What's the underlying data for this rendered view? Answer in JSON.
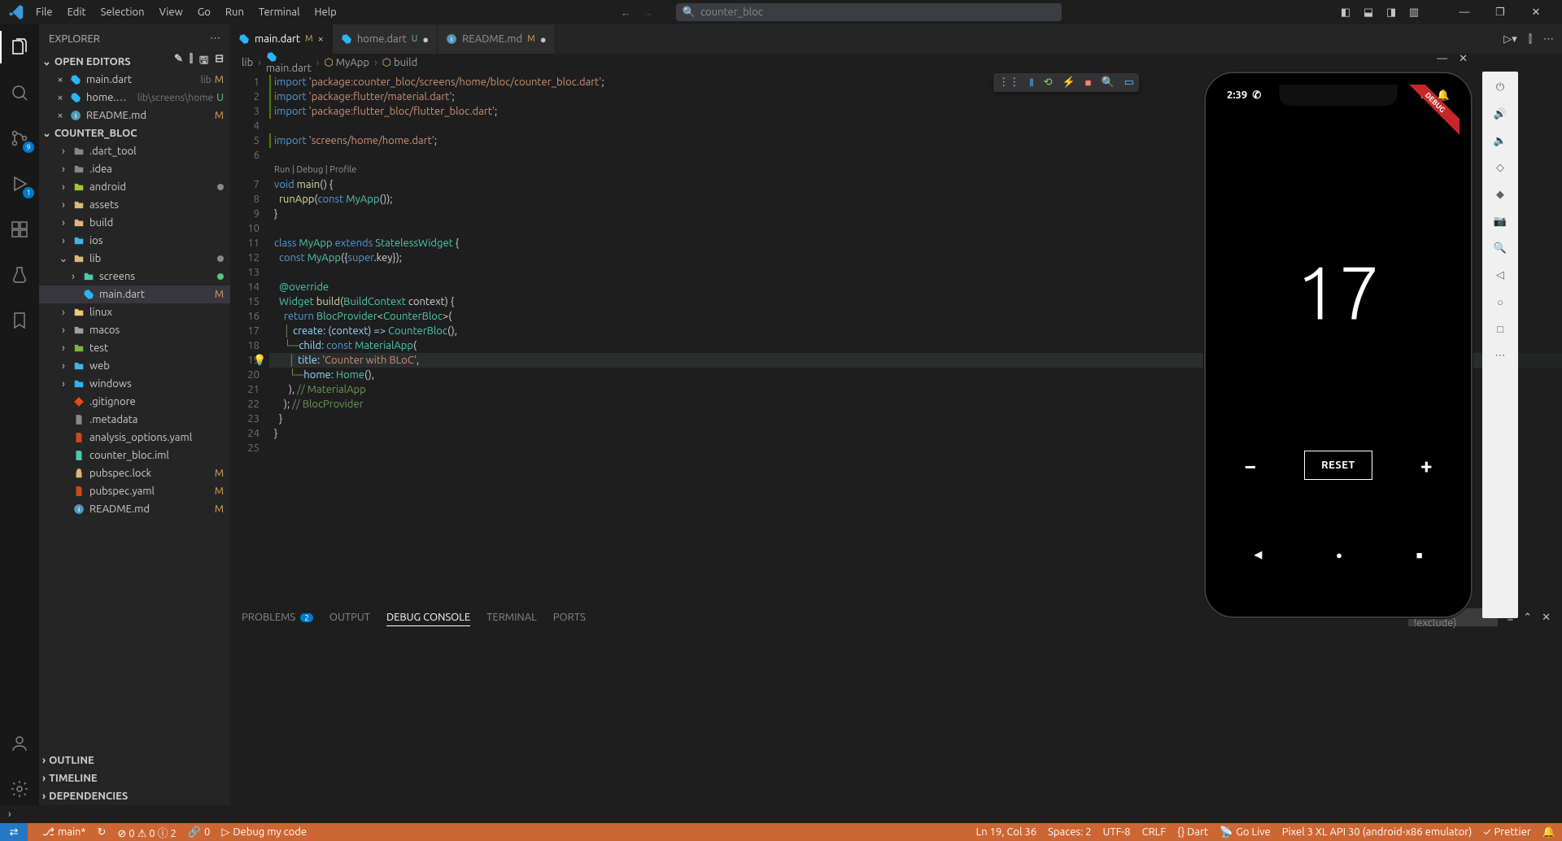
{
  "titlebar": {
    "menu": [
      "File",
      "Edit",
      "Selection",
      "View",
      "Go",
      "Run",
      "Terminal",
      "Help"
    ],
    "search": "counter_bloc"
  },
  "activitybar": {
    "sourceControlBadge": "9",
    "debugBadge": "1"
  },
  "sidebar": {
    "title": "EXPLORER",
    "section_open_editors": "OPEN EDITORS",
    "openEditors": [
      {
        "icon": "dart",
        "name": "main.dart",
        "desc": "lib",
        "badge": "M"
      },
      {
        "icon": "dart",
        "name": "home.dart",
        "desc": "lib\\screens\\home",
        "badge": "U"
      },
      {
        "icon": "info",
        "name": "README.md",
        "desc": "",
        "badge": "M",
        "dotColor": "#fff"
      }
    ],
    "section_project": "COUNTER_BLOC",
    "tree": [
      {
        "indent": 1,
        "tw": ">",
        "icon": "folder",
        "name": ".dart_tool",
        "color": "#888"
      },
      {
        "indent": 1,
        "tw": ">",
        "icon": "folder",
        "name": ".idea",
        "color": "#888"
      },
      {
        "indent": 1,
        "tw": ">",
        "icon": "folder-and",
        "name": "android",
        "color": "#a4c639",
        "dot": "#888888"
      },
      {
        "indent": 1,
        "tw": ">",
        "icon": "folder",
        "name": "assets",
        "color": "#dcb67a"
      },
      {
        "indent": 1,
        "tw": ">",
        "icon": "folder",
        "name": "build",
        "color": "#dcb67a"
      },
      {
        "indent": 1,
        "tw": ">",
        "icon": "folder",
        "name": "ios",
        "color": "#41b6e6"
      },
      {
        "indent": 1,
        "tw": "v",
        "icon": "folder",
        "name": "lib",
        "color": "#dcb67a",
        "dot": "#888888"
      },
      {
        "indent": 2,
        "tw": ">",
        "icon": "folder",
        "name": "screens",
        "color": "#4ec9b0",
        "dot": "#50c878"
      },
      {
        "indent": 2,
        "tw": "",
        "icon": "dart",
        "name": "main.dart",
        "badge": "M",
        "selected": true
      },
      {
        "indent": 1,
        "tw": ">",
        "icon": "folder",
        "name": "linux",
        "color": "#f0c674"
      },
      {
        "indent": 1,
        "tw": ">",
        "icon": "folder",
        "name": "macos",
        "color": "#a0a0a0"
      },
      {
        "indent": 1,
        "tw": ">",
        "icon": "folder",
        "name": "test",
        "color": "#7cb342"
      },
      {
        "indent": 1,
        "tw": ">",
        "icon": "folder",
        "name": "web",
        "color": "#41b6e6"
      },
      {
        "indent": 1,
        "tw": ">",
        "icon": "folder",
        "name": "windows",
        "color": "#29b6f6"
      },
      {
        "indent": 1,
        "tw": "",
        "icon": "git",
        "name": ".gitignore"
      },
      {
        "indent": 1,
        "tw": "",
        "icon": "file",
        "name": ".metadata"
      },
      {
        "indent": 1,
        "tw": "",
        "icon": "yaml",
        "name": "analysis_options.yaml",
        "iconColor": "#cb4b16"
      },
      {
        "indent": 1,
        "tw": "",
        "icon": "file",
        "name": "counter_bloc.iml",
        "iconColor": "#4ec9b0"
      },
      {
        "indent": 1,
        "tw": "",
        "icon": "lock",
        "name": "pubspec.lock",
        "badge": "M",
        "iconColor": "#dcb67a"
      },
      {
        "indent": 1,
        "tw": "",
        "icon": "yaml",
        "name": "pubspec.yaml",
        "badge": "M",
        "iconColor": "#cb4b16"
      },
      {
        "indent": 1,
        "tw": "",
        "icon": "info",
        "name": "README.md",
        "badge": "M"
      }
    ],
    "bottom": [
      "OUTLINE",
      "TIMELINE",
      "DEPENDENCIES"
    ]
  },
  "tabs": [
    {
      "icon": "dart",
      "name": "main.dart",
      "status": "M",
      "active": true,
      "close": "×"
    },
    {
      "icon": "dart",
      "name": "home.dart",
      "status": "U",
      "close": "●",
      "statusColor": "#6fc28b"
    },
    {
      "icon": "info",
      "name": "README.md",
      "status": "M",
      "close": "●"
    }
  ],
  "breadcrumb": [
    "lib",
    "main.dart",
    "MyApp",
    "build"
  ],
  "code": {
    "codelens": "Run | Debug | Profile",
    "lines": [
      [
        {
          "t": "import ",
          "c": "tk-kw"
        },
        {
          "t": "'package:counter_bloc/screens/home/bloc/counter_bloc.dart'",
          "c": "tk-str"
        },
        {
          "t": ";",
          "c": "tk-p"
        }
      ],
      [
        {
          "t": "import ",
          "c": "tk-kw"
        },
        {
          "t": "'package:flutter/material.dart'",
          "c": "tk-str"
        },
        {
          "t": ";",
          "c": "tk-p"
        }
      ],
      [
        {
          "t": "import ",
          "c": "tk-kw"
        },
        {
          "t": "'package:flutter_bloc/flutter_bloc.dart'",
          "c": "tk-str"
        },
        {
          "t": ";",
          "c": "tk-p"
        }
      ],
      [],
      [
        {
          "t": "import ",
          "c": "tk-kw"
        },
        {
          "t": "'screens/home/home.dart'",
          "c": "tk-str"
        },
        {
          "t": ";",
          "c": "tk-p"
        }
      ],
      [],
      "CODELENS",
      [
        {
          "t": "void ",
          "c": "tk-kw"
        },
        {
          "t": "main",
          "c": "tk-fn"
        },
        {
          "t": "() {",
          "c": "tk-p"
        }
      ],
      [
        {
          "t": "  ",
          "c": ""
        },
        {
          "t": "runApp",
          "c": "tk-fn"
        },
        {
          "t": "(",
          "c": "tk-p"
        },
        {
          "t": "const ",
          "c": "tk-kw"
        },
        {
          "t": "MyApp",
          "c": "tk-cls"
        },
        {
          "t": "());",
          "c": "tk-p"
        }
      ],
      [
        {
          "t": "}",
          "c": "tk-p"
        }
      ],
      [],
      [
        {
          "t": "class ",
          "c": "tk-kw"
        },
        {
          "t": "MyApp ",
          "c": "tk-cls"
        },
        {
          "t": "extends ",
          "c": "tk-kw"
        },
        {
          "t": "StatelessWidget ",
          "c": "tk-cls"
        },
        {
          "t": "{",
          "c": "tk-p"
        }
      ],
      [
        {
          "t": "  ",
          "c": ""
        },
        {
          "t": "const ",
          "c": "tk-kw"
        },
        {
          "t": "MyApp",
          "c": "tk-cls"
        },
        {
          "t": "({",
          "c": "tk-p"
        },
        {
          "t": "super",
          "c": "tk-kw"
        },
        {
          "t": ".key});",
          "c": "tk-p"
        }
      ],
      [],
      [
        {
          "t": "  ",
          "c": ""
        },
        {
          "t": "@override",
          "c": "tk-d"
        }
      ],
      [
        {
          "t": "  ",
          "c": ""
        },
        {
          "t": "Widget ",
          "c": "tk-cls"
        },
        {
          "t": "build",
          "c": "tk-fn"
        },
        {
          "t": "(",
          "c": "tk-p"
        },
        {
          "t": "BuildContext ",
          "c": "tk-cls"
        },
        {
          "t": "context) {",
          "c": "tk-p"
        }
      ],
      [
        {
          "t": "    ",
          "c": ""
        },
        {
          "t": "return ",
          "c": "tk-kw"
        },
        {
          "t": "BlocProvider",
          "c": "tk-cls"
        },
        {
          "t": "<",
          "c": "tk-p"
        },
        {
          "t": "CounterBloc",
          "c": "tk-cls"
        },
        {
          "t": ">(",
          "c": "tk-p"
        }
      ],
      [
        {
          "t": "    ",
          "c": ""
        },
        {
          "t": "│ ",
          "c": "tk-c"
        },
        {
          "t": "create: (context) => ",
          "c": "tk-v"
        },
        {
          "t": "CounterBloc",
          "c": "tk-cls"
        },
        {
          "t": "(),",
          "c": "tk-p"
        }
      ],
      [
        {
          "t": "    ",
          "c": ""
        },
        {
          "t": "└─",
          "c": "tk-c"
        },
        {
          "t": "child: ",
          "c": "tk-v"
        },
        {
          "t": "const ",
          "c": "tk-kw"
        },
        {
          "t": "MaterialApp",
          "c": "tk-cls"
        },
        {
          "t": "(",
          "c": "tk-p"
        }
      ],
      [
        {
          "t": "      ",
          "c": ""
        },
        {
          "t": "│ ",
          "c": "tk-c"
        },
        {
          "t": "title: ",
          "c": "tk-v"
        },
        {
          "t": "'Counter with BLoC'",
          "c": "tk-str"
        },
        {
          "t": ",",
          "c": "tk-p"
        }
      ],
      [
        {
          "t": "      ",
          "c": ""
        },
        {
          "t": "└─",
          "c": "tk-c"
        },
        {
          "t": "home: ",
          "c": "tk-v"
        },
        {
          "t": "Home",
          "c": "tk-cls"
        },
        {
          "t": "(),",
          "c": "tk-p"
        }
      ],
      [
        {
          "t": "      ),",
          "c": "tk-p"
        },
        {
          "t": " // MaterialApp",
          "c": "tk-c"
        }
      ],
      [
        {
          "t": "    );",
          "c": "tk-p"
        },
        {
          "t": " // BlocProvider",
          "c": "tk-c"
        }
      ],
      [
        {
          "t": "  }",
          "c": "tk-p"
        }
      ],
      [
        {
          "t": "}",
          "c": "tk-p"
        }
      ],
      []
    ],
    "highlight": 19
  },
  "panel": {
    "tabs": [
      {
        "label": "PROBLEMS",
        "badge": "2"
      },
      {
        "label": "OUTPUT"
      },
      {
        "label": "DEBUG CONSOLE",
        "active": true
      },
      {
        "label": "TERMINAL"
      },
      {
        "label": "PORTS"
      }
    ],
    "filter_placeholder": "e.g. text, !exclude)"
  },
  "statusbar": {
    "branch": "main*",
    "sync": "",
    "errors_warnings": "⊘ 0  ⚠ 0  ⓘ 2",
    "ws": "0",
    "debug_label": "Debug my code",
    "right": [
      "Ln 19, Col 36",
      "Spaces: 2",
      "UTF-8",
      "CRLF",
      "{} Dart",
      "Go Live",
      "Pixel 3 XL API 30 (android-x86 emulator)",
      "Prettier"
    ]
  },
  "emulator": {
    "time": "2:39",
    "counter": "17",
    "reset": "RESET",
    "debugBanner": "DEBUG"
  }
}
